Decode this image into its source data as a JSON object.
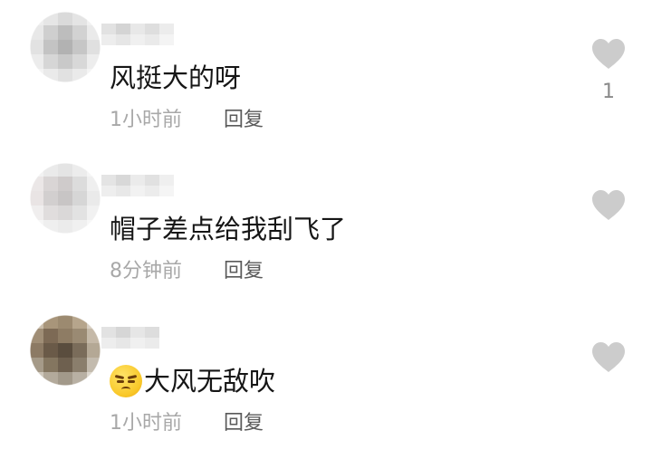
{
  "comments": [
    {
      "text": "风挺大的呀",
      "time": "1小时前",
      "reply_label": "回复",
      "likes": "1",
      "liked": false
    },
    {
      "text": "帽子差点给我刮飞了",
      "time": "8分钟前",
      "reply_label": "回复",
      "likes": "",
      "liked": false
    },
    {
      "emoji": "frowning-face-emoji",
      "text": "大风无敌吹",
      "time": "1小时前",
      "reply_label": "回复",
      "likes": "",
      "liked": false
    }
  ],
  "colors": {
    "text": "#161616",
    "meta": "#a8a8a8",
    "reply": "#5a5a5a",
    "like_icon": "#cccccc"
  }
}
